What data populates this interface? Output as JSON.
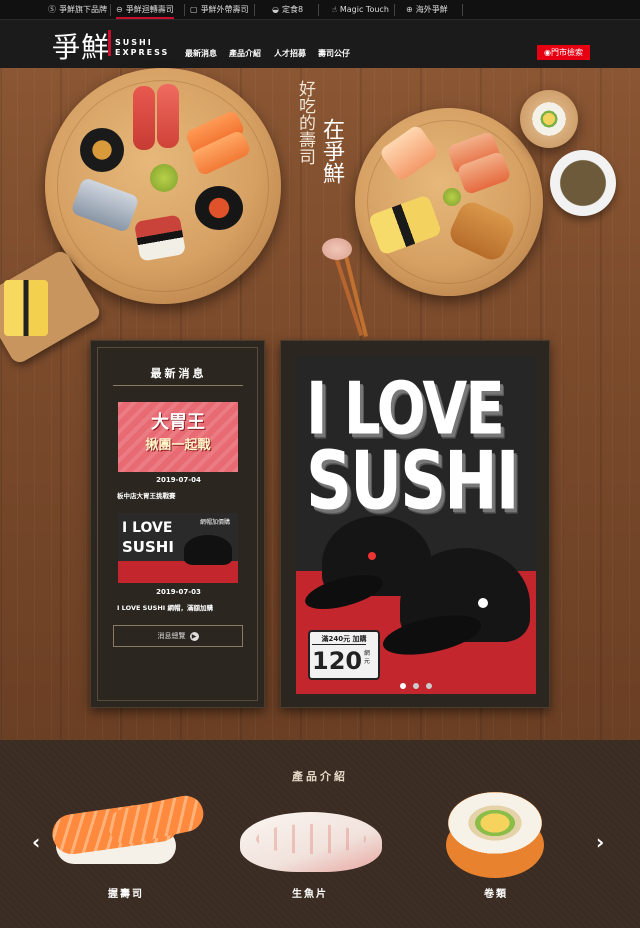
{
  "topbar": {
    "brands": [
      {
        "icon": "s-icon",
        "glyph": "Ⓢ",
        "label": "爭鮮旗下品牌"
      },
      {
        "icon": "sushi-plate-icon",
        "glyph": "⊖",
        "label": "爭鮮迴轉壽司"
      },
      {
        "icon": "bag-icon",
        "glyph": "▢",
        "label": "爭鮮外帶壽司"
      },
      {
        "icon": "bowl-icon",
        "glyph": "◒",
        "label": "定食8"
      },
      {
        "icon": "hand-icon",
        "glyph": "☝",
        "label": "Magic Touch"
      },
      {
        "icon": "globe-icon",
        "glyph": "⊕",
        "label": "海外爭鮮"
      }
    ]
  },
  "header": {
    "logo_cn": "爭鮮",
    "logo_en_line1": "SUSHI",
    "logo_en_line2": "EXPRESS",
    "nav": [
      "最新消息",
      "產品介紹",
      "人才招募",
      "壽司公仔"
    ],
    "store_button": "門市檢索",
    "accent": "#e60012"
  },
  "hero": {
    "slogan_1": "好吃的壽司",
    "slogan_2": "在爭鮮"
  },
  "news": {
    "title": "最新消息",
    "items": [
      {
        "image_text_1": "大胃王",
        "image_text_2": "揪團一起戰",
        "date": "2019-07-04",
        "caption": "板中店大胃王挑戰賽"
      },
      {
        "image_text_1": "I LOVE",
        "image_text_2": "SUSHI",
        "image_text_3": "網帽加價購",
        "date": "2019-07-03",
        "caption": "I LOVE SUSHI 網帽，滿額加購"
      }
    ],
    "more_button": "消息總覽"
  },
  "banner": {
    "line1": "I LOVE",
    "line2": "SUSHI",
    "promo_top": "滿240元 加購",
    "promo_price": "120",
    "promo_unit_1": "網",
    "promo_unit_2": "元",
    "slides": 3,
    "active_slide": 0
  },
  "products": {
    "title": "產品介紹",
    "items": [
      {
        "label": "握壽司"
      },
      {
        "label": "生魚片"
      },
      {
        "label": "卷類"
      }
    ],
    "prev": "‹",
    "next": "›"
  }
}
